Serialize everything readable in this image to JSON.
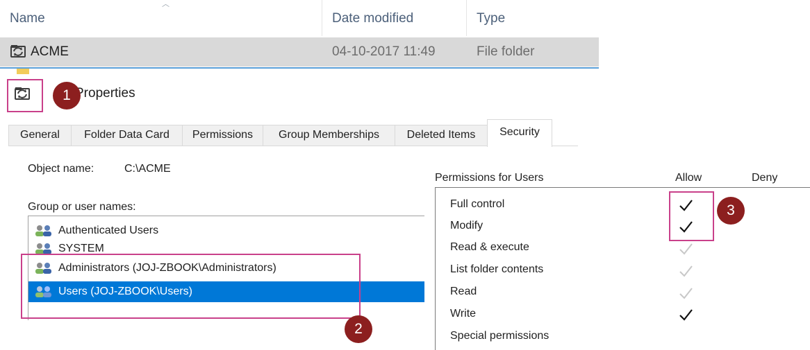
{
  "explorer": {
    "columns": {
      "name": "Name",
      "date_modified": "Date modified",
      "type": "Type"
    },
    "rows": [
      {
        "name": "ACME",
        "date_modified": "04-10-2017 11:49",
        "type": "File folder",
        "selected": true
      }
    ]
  },
  "dialog": {
    "title": "Properties",
    "tabs": [
      "General",
      "Folder Data Card",
      "Permissions",
      "Group Memberships",
      "Deleted Items",
      "Security"
    ],
    "active_tab": "Security",
    "object_name_label": "Object name:",
    "object_name_value": "C:\\ACME",
    "group_label": "Group or user names:",
    "groups": [
      {
        "name": "Authenticated Users"
      },
      {
        "name": "SYSTEM"
      },
      {
        "name": "Administrators (JOJ-ZBOOK\\Administrators)"
      },
      {
        "name": "Users (JOJ-ZBOOK\\Users)",
        "selected": true
      }
    ],
    "permissions_label": "Permissions for Users",
    "allow_label": "Allow",
    "deny_label": "Deny",
    "permissions": [
      {
        "name": "Full control",
        "allow": "checked"
      },
      {
        "name": "Modify",
        "allow": "checked"
      },
      {
        "name": "Read & execute",
        "allow": "inherited"
      },
      {
        "name": "List folder contents",
        "allow": "inherited"
      },
      {
        "name": "Read",
        "allow": "inherited"
      },
      {
        "name": "Write",
        "allow": "checked"
      },
      {
        "name": "Special permissions",
        "allow": "none"
      }
    ]
  },
  "annotations": {
    "step1": "1",
    "step2": "2",
    "step3": "3"
  },
  "colors": {
    "accent": "#0078d7",
    "highlight": "#c9408a",
    "badge": "#8c1f1f"
  },
  "icons": {
    "folder_sync": "folder-sync-icon",
    "users": "users-group-icon",
    "check": "checkmark-icon"
  }
}
